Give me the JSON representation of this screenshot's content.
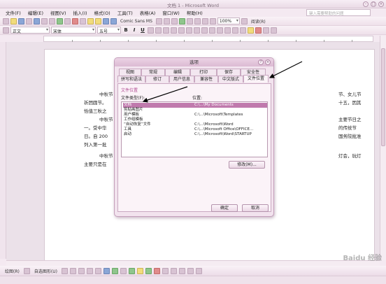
{
  "window": {
    "title": "文档 1 - Microsoft Word",
    "help_placeholder": "键入需要帮助的问题"
  },
  "menu": [
    "文件(F)",
    "编辑(E)",
    "视图(V)",
    "插入(I)",
    "格式(O)",
    "工具(T)",
    "表格(A)",
    "窗口(W)",
    "帮助(H)"
  ],
  "toolbar": {
    "style": "正文",
    "font": "宋体",
    "size": "五号",
    "special_font": "Comic Sans MS",
    "zoom": "100%",
    "read_label": "阅读(R)",
    "bold": "B",
    "italic": "I",
    "underline": "U"
  },
  "document": {
    "lines": [
      "中秋节",
      "节、女儿节",
      "祈团圆节。",
      "十五，因其",
      "恰值三秋之",
      "中秋节",
      "主要节日之",
      "一。受中华",
      "的传统节",
      "日。自 200",
      "国务院批准",
      "列入第一批",
      "中秋节",
      "灯会，玩灯",
      "主要只是在"
    ]
  },
  "dialog": {
    "title": "选项",
    "help": "?",
    "close": "×",
    "tabs_row1": [
      "视图",
      "常规",
      "编辑",
      "打印",
      "保存",
      "安全性"
    ],
    "tabs_row2": [
      "拼写和语法",
      "修订",
      "用户信息",
      "兼容性",
      "中文版式",
      "文件位置"
    ],
    "section_label": "文件位置",
    "col_type": "文件类型(F):",
    "col_location": "位置:",
    "rows": [
      {
        "type": "文档",
        "location": "C:\\...\\My Documents",
        "selected": true
      },
      {
        "type": "剪贴画图片",
        "location": "",
        "selected": false
      },
      {
        "type": "用户模板",
        "location": "C:\\...\\Microsoft\\Templates",
        "selected": false
      },
      {
        "type": "工作组模板",
        "location": "",
        "selected": false
      },
      {
        "type": "“自动恢复”文件",
        "location": "C:\\...\\Microsoft\\Word",
        "selected": false
      },
      {
        "type": "工具",
        "location": "C:\\...\\Microsoft Office\\OFFICE...",
        "selected": false
      },
      {
        "type": "启动",
        "location": "C:\\...\\Microsoft\\Word\\STARTUP",
        "selected": false
      }
    ],
    "modify_button": "修改(M)...",
    "ok_button": "确定",
    "cancel_button": "取消"
  },
  "drawbar": {
    "draw_label": "绘图(R)",
    "autoshape_label": "自选图形(U)"
  },
  "watermark": "Baidu 经验"
}
